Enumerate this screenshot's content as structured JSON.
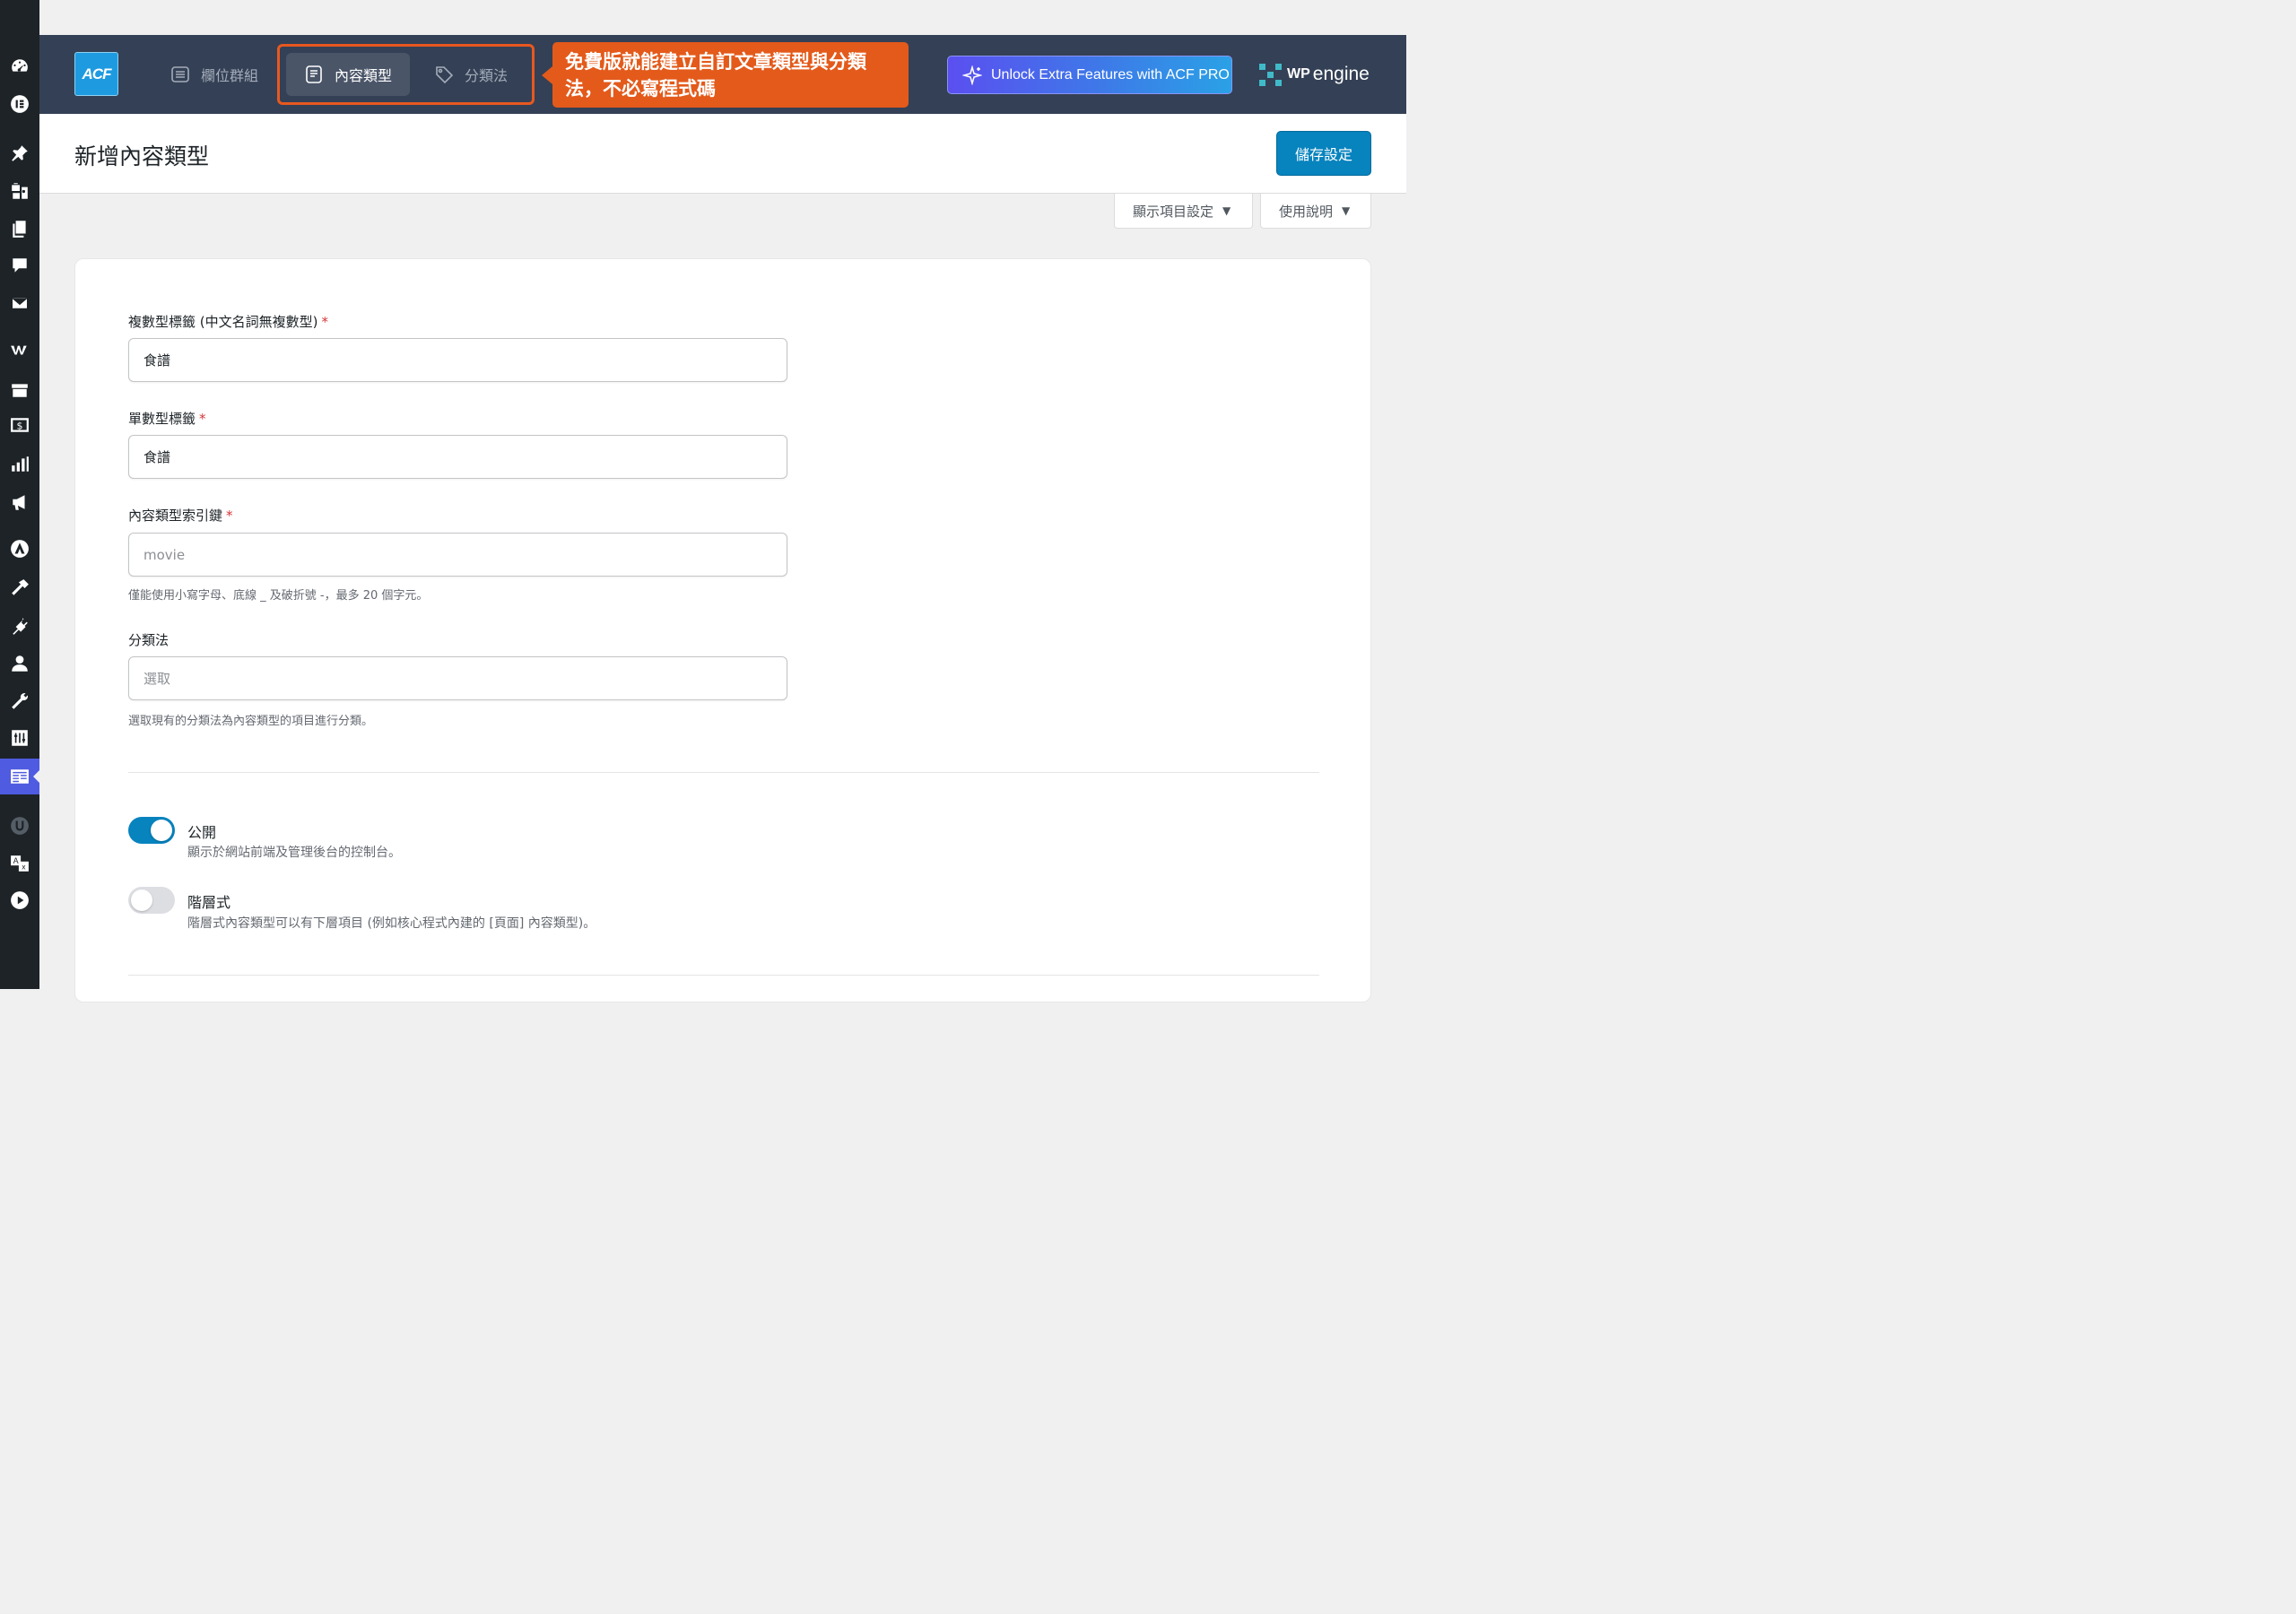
{
  "header": {
    "logo_text": "ACF",
    "tabs": [
      {
        "label": "欄位群組",
        "icon": "field-groups-icon"
      },
      {
        "label": "內容類型",
        "icon": "post-type-icon",
        "active": true
      },
      {
        "label": "分類法",
        "icon": "tag-icon"
      }
    ],
    "callout_text": "免費版就能建立自訂文章類型與分類法，不必寫程式碼",
    "unlock_label": "Unlock Extra Features with ACF PRO",
    "wpe_brand_wp": "WP",
    "wpe_brand_engine": "engine"
  },
  "page": {
    "title": "新增內容類型",
    "save_label": "儲存設定",
    "screen_options_label": "顯示項目設定",
    "help_label": "使用說明"
  },
  "form": {
    "plural_label": "複數型標籤 (中文名詞無複數型)",
    "plural_value": "食譜",
    "singular_label": "單數型標籤",
    "singular_value": "食譜",
    "key_label": "內容類型索引鍵",
    "key_placeholder": "movie",
    "key_help": "僅能使用小寫字母、底線 _ 及破折號 -，最多 20 個字元。",
    "taxonomy_label": "分類法",
    "taxonomy_placeholder": "選取",
    "taxonomy_help": "選取現有的分類法為內容類型的項目進行分類。",
    "required_mark": "*"
  },
  "toggles": {
    "public": {
      "title": "公開",
      "desc": "顯示於網站前端及管理後台的控制台。",
      "on": true
    },
    "hierarchical": {
      "title": "階層式",
      "desc": "階層式內容類型可以有下層項目 (例如核心程式內建的 [頁面] 內容類型)。",
      "on": false
    }
  },
  "colors": {
    "header_bg": "#344055",
    "accent": "#0783be",
    "callout": "#e35a1b",
    "sidebar_bg": "#1d2327"
  }
}
